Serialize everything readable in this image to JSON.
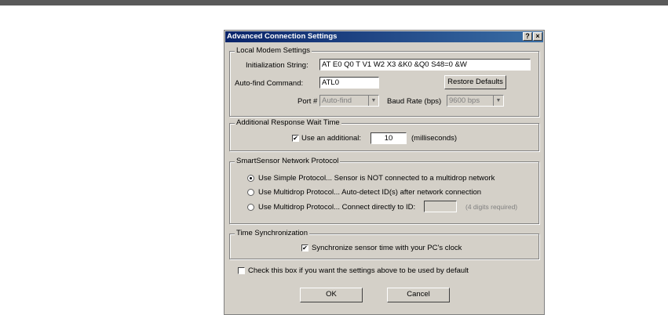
{
  "window": {
    "title": "Advanced Connection Settings",
    "help_glyph": "?",
    "close_glyph": "×"
  },
  "local_modem": {
    "legend": "Local Modem Settings",
    "init_label": "Initialization String:",
    "init_value": "AT E0 Q0 T V1 W2 X3 &K0 &Q0 S48=0 &W",
    "autofind_label": "Auto-find Command:",
    "autofind_value": "ATL0",
    "restore_button": "Restore Defaults",
    "port_label": "Port #",
    "port_value": "Auto-find",
    "baud_label": "Baud Rate (bps)",
    "baud_value": "9600 bps"
  },
  "wait_time": {
    "legend": "Additional Response Wait Time",
    "checkbox_label": "Use an additional:",
    "checked": true,
    "value": "10",
    "unit": "(milliseconds)"
  },
  "protocol": {
    "legend": "SmartSensor Network Protocol",
    "options": [
      {
        "label": "Use Simple Protocol... Sensor is NOT connected to a multidrop network",
        "selected": true
      },
      {
        "label": "Use Multidrop Protocol... Auto-detect ID(s) after network connection",
        "selected": false
      },
      {
        "label": "Use Multidrop Protocol... Connect directly to ID:",
        "selected": false
      }
    ],
    "id_value": "",
    "id_hint": "(4 digits required)"
  },
  "time_sync": {
    "legend": "Time Synchronization",
    "checkbox_label": "Synchronize sensor time with your PC's clock",
    "checked": true
  },
  "default_checkbox": {
    "label": "Check this box if you want the settings above to be used by default",
    "checked": false
  },
  "buttons": {
    "ok": "OK",
    "cancel": "Cancel"
  },
  "check_glyph": "✔"
}
